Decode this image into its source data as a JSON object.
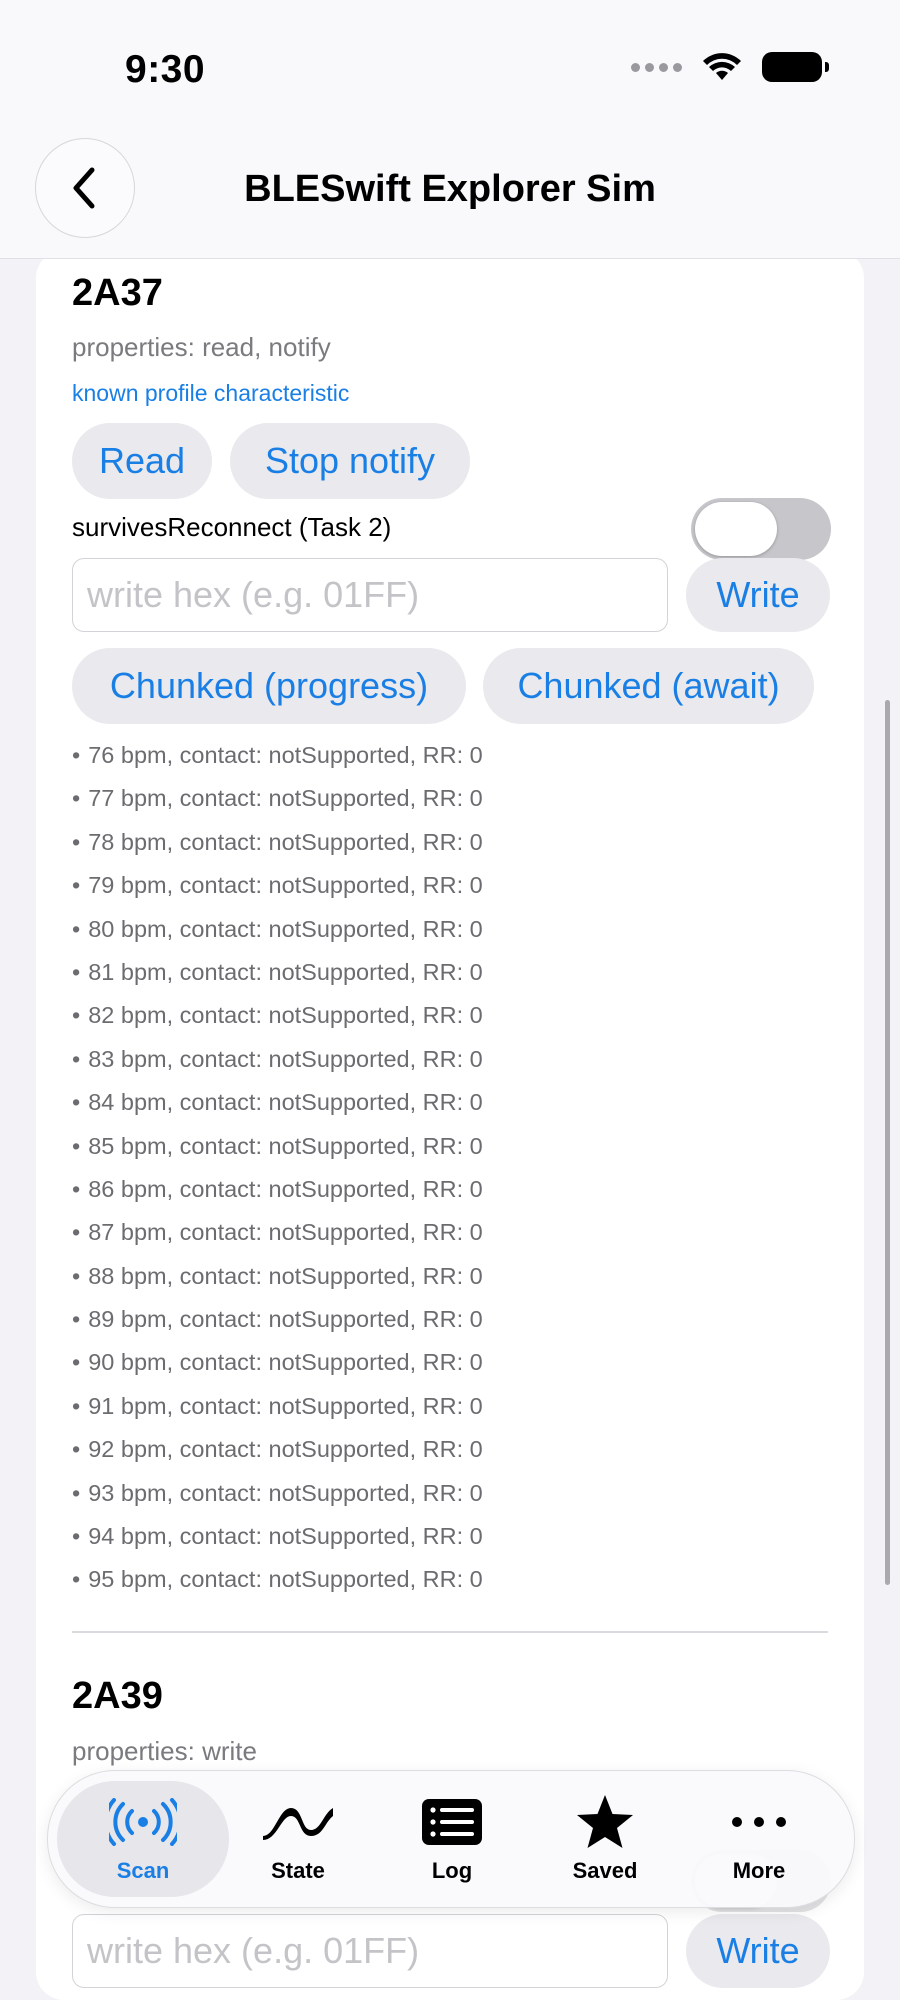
{
  "status": {
    "time": "9:30"
  },
  "nav": {
    "title": "BLESwift Explorer Sim"
  },
  "char1": {
    "title": "2A37",
    "properties": "properties: read, notify",
    "known": "known profile characteristic",
    "read_label": "Read",
    "stop_notify_label": "Stop notify",
    "toggle_label": "survivesReconnect (Task 2)",
    "toggle_on": false,
    "input_placeholder": "write hex (e.g. 01FF)",
    "write_label": "Write",
    "chunked_progress_label": "Chunked (progress)",
    "chunked_await_label": "Chunked (await)",
    "log": [
      "76 bpm, contact: notSupported, RR: 0",
      "77 bpm, contact: notSupported, RR: 0",
      "78 bpm, contact: notSupported, RR: 0",
      "79 bpm, contact: notSupported, RR: 0",
      "80 bpm, contact: notSupported, RR: 0",
      "81 bpm, contact: notSupported, RR: 0",
      "82 bpm, contact: notSupported, RR: 0",
      "83 bpm, contact: notSupported, RR: 0",
      "84 bpm, contact: notSupported, RR: 0",
      "85 bpm, contact: notSupported, RR: 0",
      "86 bpm, contact: notSupported, RR: 0",
      "87 bpm, contact: notSupported, RR: 0",
      "88 bpm, contact: notSupported, RR: 0",
      "89 bpm, contact: notSupported, RR: 0",
      "90 bpm, contact: notSupported, RR: 0",
      "91 bpm, contact: notSupported, RR: 0",
      "92 bpm, contact: notSupported, RR: 0",
      "93 bpm, contact: notSupported, RR: 0",
      "94 bpm, contact: notSupported, RR: 0",
      "95 bpm, contact: notSupported, RR: 0"
    ]
  },
  "char2": {
    "title": "2A39",
    "properties": "properties: write",
    "input_placeholder": "write hex (e.g. 01FF)",
    "write_label": "Write"
  },
  "tabs": [
    {
      "label": "Scan",
      "icon": "broadcast-icon",
      "selected": true
    },
    {
      "label": "State",
      "icon": "wave-icon",
      "selected": false
    },
    {
      "label": "Log",
      "icon": "list-icon",
      "selected": false
    },
    {
      "label": "Saved",
      "icon": "star-icon",
      "selected": false
    },
    {
      "label": "More",
      "icon": "ellipsis-icon",
      "selected": false
    }
  ],
  "colors": {
    "accent": "#1a7fe5",
    "background": "#f2f2f7",
    "secondary_text": "#6c6c70"
  }
}
